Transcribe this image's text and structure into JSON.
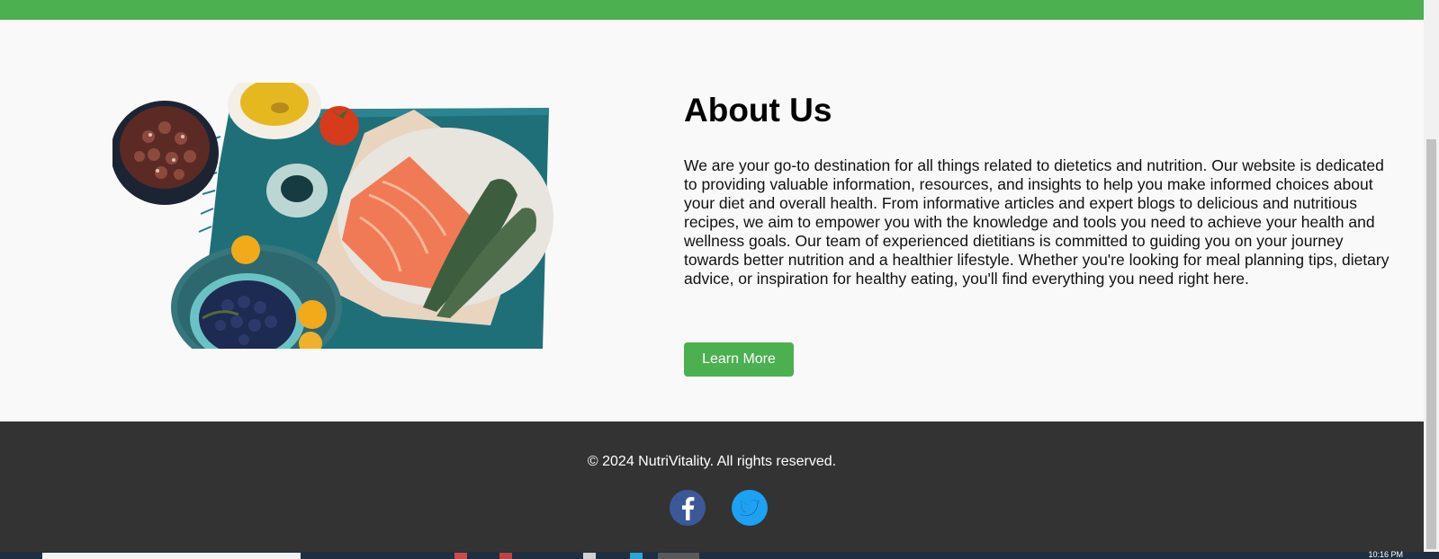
{
  "about": {
    "title": "About Us",
    "body": "We are your go-to destination for all things related to dietetics and nutrition. Our website is dedicated to providing valuable information, resources, and insights to help you make informed choices about your diet and overall health. From informative articles and expert blogs to delicious and nutritious recipes, we aim to empower you with the knowledge and tools you need to achieve your health and wellness goals. Our team of experienced dietitians is committed to guiding you on your journey towards better nutrition and a healthier lifestyle. Whether you're looking for meal planning tips, dietary advice, or inspiration for healthy eating, you'll find everything you need right here.",
    "button_label": "Learn More",
    "image_icon": "food-photo-icon"
  },
  "footer": {
    "copyright": "© 2024 NutriVitality. All rights reserved.",
    "social": [
      {
        "name": "facebook-icon",
        "color": "#3b5998"
      },
      {
        "name": "twitter-icon",
        "color": "#1da1f2"
      }
    ]
  },
  "taskbar": {
    "clock": "10:16 PM"
  },
  "colors": {
    "accent": "#4caf50",
    "footer_bg": "#333333",
    "page_bg": "#f9f9f9"
  }
}
